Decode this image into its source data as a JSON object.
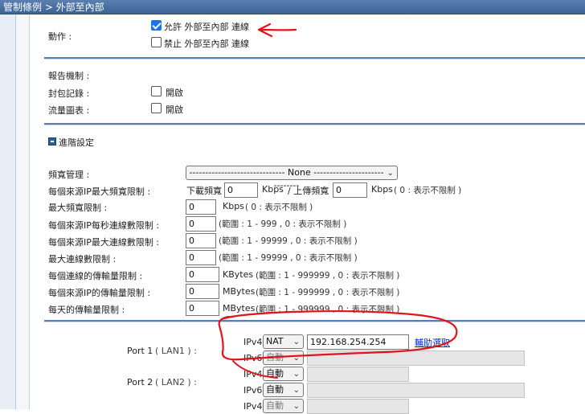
{
  "breadcrumb": "管制條例 > 外部至內部",
  "action": {
    "label": "動作 :",
    "allow": {
      "label": "允許 外部至內部 連線",
      "checked": true
    },
    "deny": {
      "label": "禁止 外部至內部 連線",
      "checked": false
    }
  },
  "report": {
    "title": "報告機制 :",
    "packet_log": {
      "label": "封包記錄 :",
      "option": "開啟",
      "checked": false
    },
    "traffic_chart": {
      "label": "流量圖表 :",
      "option": "開啟",
      "checked": false
    }
  },
  "advanced": {
    "title": "進階設定",
    "bandwidth": {
      "label": "頻寬管理 :",
      "selected": "------------------------------ None ------------------------------"
    },
    "per_ip_max_bw": {
      "label": "每個來源IP最大頻寬限制 :",
      "down_label": "下載頻寬",
      "down_value": "0",
      "unit1": "Kbps",
      "up_label": "/ 上傳頻寬",
      "up_value": "0",
      "unit2": "Kbps",
      "hint": "( 0 : 表示不限制 )"
    },
    "max_bw": {
      "label": "最大頻寬限制 :",
      "value": "0",
      "unit": "Kbps",
      "hint": "( 0 : 表示不限制 )"
    },
    "per_ip_conn_rate": {
      "label": "每個來源IP每秒連線數限制 :",
      "value": "0",
      "hint": "(範圍 : 1 - 999 , 0 : 表示不限制 )"
    },
    "per_ip_max_conn": {
      "label": "每個來源IP最大連線數限制 :",
      "value": "0",
      "hint": "(範圍 : 1 - 99999 , 0 : 表示不限制 )"
    },
    "max_conn": {
      "label": "最大連線數限制 :",
      "value": "0",
      "hint": "(範圍 : 1 - 99999 , 0 : 表示不限制 )"
    },
    "per_conn_transfer": {
      "label": "每個連線的傳輸量限制 :",
      "value": "0",
      "unit": "KBytes",
      "hint": "(範圍 : 1 - 999999 , 0 : 表示不限制 )"
    },
    "per_ip_transfer": {
      "label": "每個來源IP的傳輸量限制 :",
      "value": "0",
      "unit": "MBytes",
      "hint": "(範圍 : 1 - 999999 , 0 : 表示不限制 )"
    },
    "daily_transfer": {
      "label": "每天的傳輸量限制 :",
      "value": "0",
      "unit": "MBytes",
      "hint": "(範圍 : 1 - 999999 , 0 : 表示不限制 )"
    }
  },
  "ports": {
    "port1": {
      "label": "Port 1",
      "sub": "( LAN1 ) :",
      "ipv4_label": "IPv4",
      "ipv4_mode": "NAT",
      "ipv4_value": "192.168.254.254",
      "assist_link": "輔助選取",
      "ipv6_label": "IPv6",
      "ipv6_mode": "自動"
    },
    "port2": {
      "label": "Port 2",
      "sub": "( LAN2 ) :",
      "ipv4_label": "IPv4",
      "ipv4_mode": "自動",
      "ipv6_label": "IPv6",
      "ipv6_mode": "自動"
    },
    "port3": {
      "ipv4_label": "IPv4",
      "ipv4_mode": "自動"
    }
  },
  "colors": {
    "annotation": "#e0151b",
    "accent": "#1a73e8",
    "header": "#4a6fa3"
  }
}
